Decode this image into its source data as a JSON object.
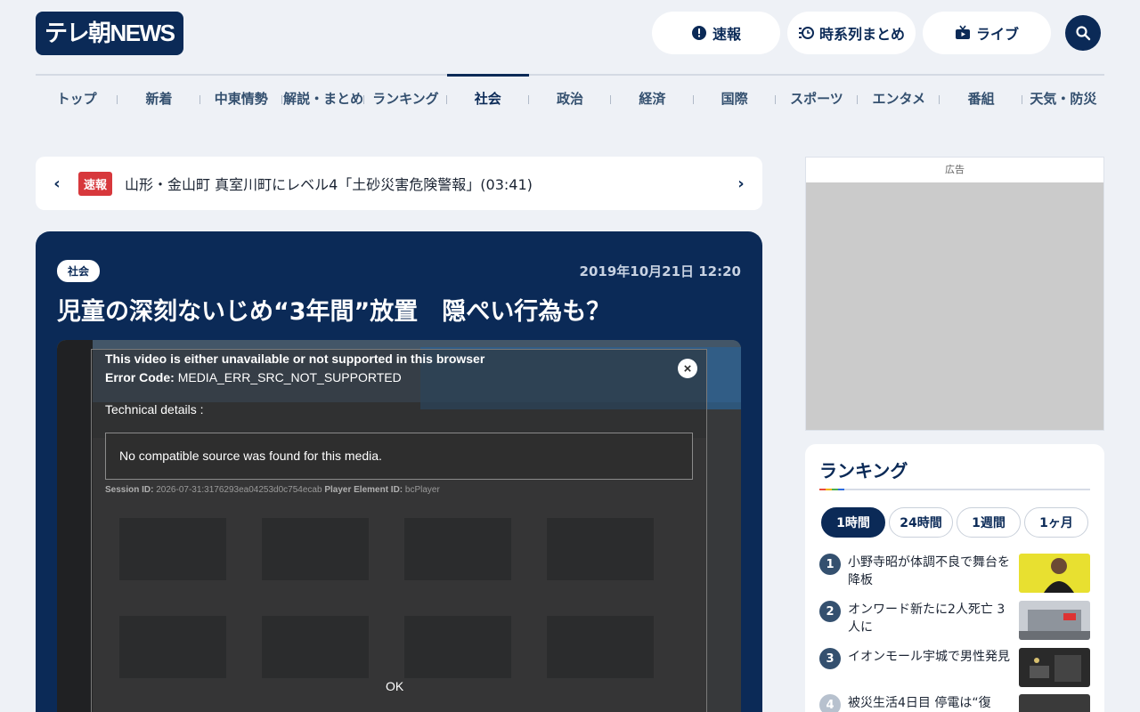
{
  "header": {
    "logo_text": "テレ朝NEWS",
    "buttons": [
      {
        "label": "速報",
        "icon": "alert-circle-icon"
      },
      {
        "label": "時系列まとめ",
        "icon": "timeline-icon"
      },
      {
        "label": "ライブ",
        "icon": "tv-live-icon"
      }
    ],
    "search_icon": "search-icon"
  },
  "nav": {
    "items": [
      "トップ",
      "新着",
      "中東情勢",
      "解説・まとめ",
      "ランキング",
      "社会",
      "政治",
      "経済",
      "国際",
      "スポーツ",
      "エンタメ",
      "番組",
      "天気・防災"
    ],
    "active": "社会"
  },
  "breaking": {
    "badge": "速報",
    "text": "山形・金山町 真室川町にレベル4「土砂災害危険警報」(03:41)",
    "prev": "‹",
    "next": "›"
  },
  "article": {
    "category": "社会",
    "date": "2019年10月21日 12:20",
    "title": "児童の深刻ないじめ“3年間”放置　隠ぺい行為も？"
  },
  "video_error": {
    "heading": "This video is either unavailable or not supported in this browser",
    "code_label": "Error Code:",
    "code_value": "MEDIA_ERR_SRC_NOT_SUPPORTED",
    "tech_label": "Technical details :",
    "message": "No compatible source was found for this media.",
    "session_label": "Session ID:",
    "session_value": "2026-07-31:3176293ea04253d0c754ecab",
    "player_label": "Player Element ID:",
    "player_value": "bcPlayer",
    "ok": "OK",
    "close": "×"
  },
  "ad": {
    "label": "広告"
  },
  "ranking": {
    "title": "ランキング",
    "tabs": [
      "1時間",
      "24時間",
      "1週間",
      "1ヶ月"
    ],
    "active_tab": "1時間",
    "items": [
      {
        "rank": "1",
        "text": "小野寺昭が体調不良で舞台を降板"
      },
      {
        "rank": "2",
        "text": "オンワード新たに2人死亡 3人に"
      },
      {
        "rank": "3",
        "text": "イオンモール宇城で男性発見"
      },
      {
        "rank": "4",
        "text": "被災生活4日目 停電は“復"
      }
    ]
  },
  "colors": {
    "navy": "#0b2a57",
    "breaking_red": "#d7383c",
    "page_bg": "#eef1f6"
  }
}
